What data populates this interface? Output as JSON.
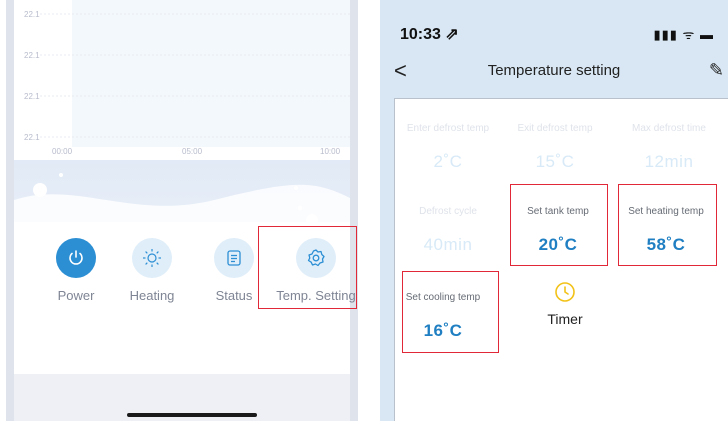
{
  "left_app": {
    "chart": {
      "y_tick_labels": [
        "22.1",
        "22.1",
        "22.1",
        "22.1"
      ],
      "x_tick_labels": [
        "00:00",
        "05:00",
        "10:00"
      ]
    },
    "controls": [
      {
        "label": "Power",
        "icon": "power-icon"
      },
      {
        "label": "Heating",
        "icon": "sun-icon"
      },
      {
        "label": "Status",
        "icon": "document-icon"
      },
      {
        "label": "Temp. Setting",
        "icon": "gear-icon"
      }
    ]
  },
  "right_app": {
    "status_bar": {
      "time": "10:33 ⇗",
      "icons": "▮▮▮ ᯤ ▬"
    },
    "nav": {
      "back": "<",
      "title": "Temperature setting",
      "edit": "✎"
    },
    "settings": [
      {
        "caption": "Enter defrost temp",
        "value": "2˚C"
      },
      {
        "caption": "Exit defrost temp",
        "value": "15˚C"
      },
      {
        "caption": "Max defrost time",
        "value": "12min"
      },
      {
        "caption": "Defrost cycle",
        "value": "40min"
      },
      {
        "caption": "Set tank temp",
        "value": "20˚C"
      },
      {
        "caption": "Set heating temp",
        "value": "58˚C"
      },
      {
        "caption": "Set cooling temp",
        "value": "16˚C"
      }
    ],
    "timer": {
      "label": "Timer",
      "icon": "clock-icon"
    }
  },
  "colors": {
    "accent": "#2c8fd4",
    "highlight": "#e02838",
    "value_blue": "#1f7fc2"
  }
}
